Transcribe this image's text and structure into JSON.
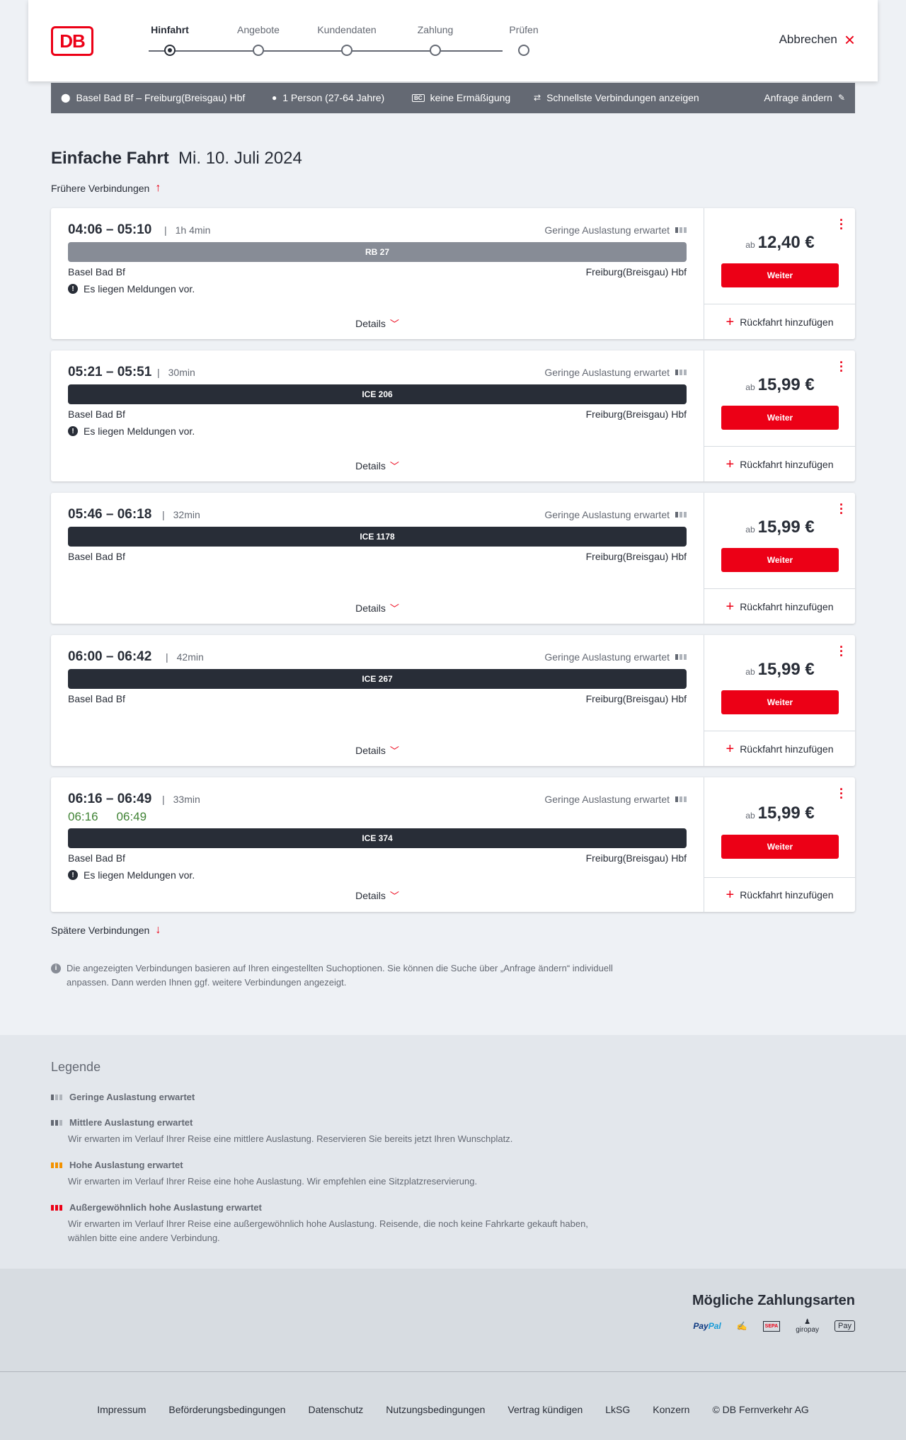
{
  "header": {
    "logo": "DB",
    "steps": [
      "Hinfahrt",
      "Angebote",
      "Kundendaten",
      "Zahlung",
      "Prüfen"
    ],
    "active_step": "Hinfahrt",
    "cancel_label": "Abbrechen"
  },
  "search": {
    "route": "Basel Bad Bf – Freiburg(Breisgau) Hbf",
    "travellers": "1 Person (27-64 Jahre)",
    "discount_badge": "BC",
    "discount": "keine Ermäßigung",
    "fastest": "Schnellste Verbindungen anzeigen",
    "change": "Anfrage ändern"
  },
  "main": {
    "title_bold": "Einfache Fahrt",
    "title_date": "Mi. 10. Juli 2024",
    "earlier": "Frühere Verbindungen",
    "later": "Spätere Verbindungen",
    "note": "Die angezeigten Verbindungen basieren auf Ihren eingestellten Suchoptionen. Sie können die Suche über „Anfrage ändern“ individuell anpassen. Dann werden Ihnen ggf. weitere Verbindungen angezeigt."
  },
  "labels": {
    "load": "Geringe Auslastung erwartet",
    "from": "ab",
    "continue": "Weiter",
    "return": "Rückfahrt hinzufügen",
    "details": "Details",
    "messages": "Es liegen Meldungen vor."
  },
  "connections": [
    {
      "times": "04:06 – 05:10",
      "duration": "1h 4min",
      "train": "RB 27",
      "train_color": "#878c96",
      "from": "Basel Bad Bf",
      "to": "Freiburg(Breisgau) Hbf",
      "messages": true,
      "price": "12,40 €"
    },
    {
      "times": "05:21 – 05:51",
      "duration": "30min",
      "train": "ICE 206",
      "train_color": "#282d37",
      "from": "Basel Bad Bf",
      "to": "Freiburg(Breisgau) Hbf",
      "messages": true,
      "price": "15,99 €"
    },
    {
      "times": "05:46 – 06:18",
      "duration": "32min",
      "train": "ICE 1178",
      "train_color": "#282d37",
      "from": "Basel Bad Bf",
      "to": "Freiburg(Breisgau) Hbf",
      "messages": false,
      "price": "15,99 €"
    },
    {
      "times": "06:00 – 06:42",
      "duration": "42min",
      "train": "ICE 267",
      "train_color": "#282d37",
      "from": "Basel Bad Bf",
      "to": "Freiburg(Breisgau) Hbf",
      "messages": false,
      "price": "15,99 €"
    },
    {
      "times": "06:16 – 06:49",
      "duration": "33min",
      "realtime_dep": "06:16",
      "realtime_arr": "06:49",
      "train": "ICE 374",
      "train_color": "#282d37",
      "from": "Basel Bad Bf",
      "to": "Freiburg(Breisgau) Hbf",
      "messages": true,
      "price": "15,99 €"
    }
  ],
  "legend": {
    "title": "Legende",
    "items": [
      {
        "title": "Geringe Auslastung erwartet",
        "desc": ""
      },
      {
        "title": "Mittlere Auslastung erwartet",
        "desc": "Wir erwarten im Verlauf Ihrer Reise eine mittlere Auslastung. Reservieren Sie bereits jetzt Ihren Wunschplatz."
      },
      {
        "title": "Hohe Auslastung erwartet",
        "desc": "Wir erwarten im Verlauf Ihrer Reise eine hohe Auslastung. Wir empfehlen eine Sitzplatzreservierung."
      },
      {
        "title": "Außergewöhnlich hohe Auslastung erwartet",
        "desc": "Wir erwarten im Verlauf Ihrer Reise eine außergewöhnlich hohe Auslastung. Reisende, die noch keine Fahrkarte gekauft haben, wählen bitte eine andere Verbindung."
      }
    ]
  },
  "payment": {
    "title": "Mögliche Zahlungsarten",
    "paypal_a": "Pay",
    "paypal_b": "Pal",
    "sepa": "SEPA",
    "giropay": "giropay",
    "applepay": "Pay"
  },
  "footer": {
    "links": [
      "Impressum",
      "Beförderungsbedingungen",
      "Datenschutz",
      "Nutzungsbedingungen",
      "Vertrag kündigen",
      "LkSG",
      "Konzern",
      "© DB Fernverkehr AG"
    ]
  },
  "colors": {
    "accent": "#ec0016",
    "dark": "#282d37",
    "realtime": "#408335",
    "high_load": "#f39200"
  }
}
